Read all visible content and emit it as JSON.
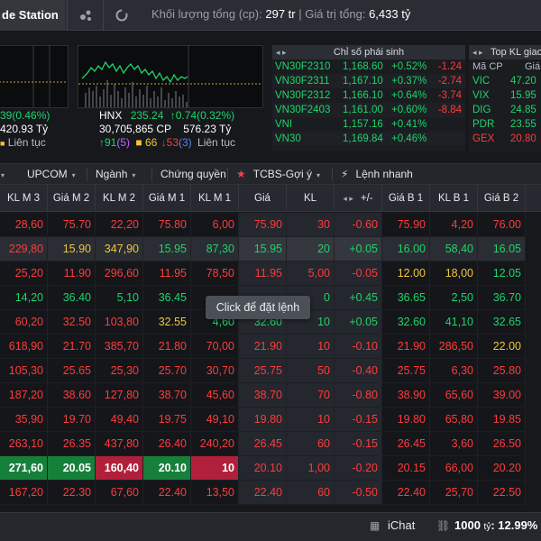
{
  "topbar": {
    "brand": "de Station",
    "volume_label": "Khối lượng tổng (cp):",
    "volume_value": "297 tr",
    "separator": "|",
    "value_label": "Giá trị tổng:",
    "value_value": "6,433 tỷ"
  },
  "index_left": {
    "change": "39(0.46%)",
    "value": "420.93 Tỷ",
    "status": "Liên tục"
  },
  "index_hnx": {
    "name": "HNX",
    "price": "235.24",
    "change": "↑0.74(0.32%)",
    "volume": "30,705,865 CP",
    "value": "576.23 Tỷ",
    "up": "↑91",
    "ceiling": "(5)",
    "ref": "■ 66",
    "down": "↓53",
    "floor": "(3)",
    "status": "Liên tục"
  },
  "derivatives": {
    "arrows": "◂ ▸",
    "title": "Chỉ số phái sinh",
    "rows": [
      {
        "code": "VN30F2310",
        "price": "1,168.60",
        "pct": "+0.52%",
        "diff": "-1.24"
      },
      {
        "code": "VN30F2311",
        "price": "1,167.10",
        "pct": "+0.37%",
        "diff": "-2.74"
      },
      {
        "code": "VN30F2312",
        "price": "1,166.10",
        "pct": "+0.64%",
        "diff": "-3.74"
      },
      {
        "code": "VN30F2403",
        "price": "1,161.00",
        "pct": "+0.60%",
        "diff": "-8.84"
      },
      {
        "code": "VNI",
        "price": "1,157.16",
        "pct": "+0.41%",
        "diff": ""
      },
      {
        "code": "VN30",
        "price": "1,169.84",
        "pct": "+0.46%",
        "diff": ""
      }
    ]
  },
  "topkl": {
    "arrows": "◂ ▸",
    "title": "Top KL giao",
    "col_code": "Mã CP",
    "col_price": "Giá",
    "rows": [
      {
        "code": "VIC",
        "price": "47.20",
        "color": "green"
      },
      {
        "code": "VIX",
        "price": "15.95",
        "color": "green"
      },
      {
        "code": "DIG",
        "price": "24.85",
        "color": "green"
      },
      {
        "code": "PDR",
        "price": "23.55",
        "color": "green"
      },
      {
        "code": "GEX",
        "price": "20.80",
        "color": "red"
      }
    ]
  },
  "tabs": [
    {
      "label": "UPCOM",
      "caret": "▾"
    },
    {
      "label": "Ngành",
      "caret": "▾"
    },
    {
      "label": "Chứng quyền",
      "caret": ""
    },
    {
      "label": "TCBS-Gợi ý",
      "caret": "▾",
      "icon": "★"
    },
    {
      "label": "Lệnh nhanh",
      "caret": "",
      "icon": "⚡"
    }
  ],
  "columns": [
    "KL M 3",
    "Giá M 2",
    "KL M 2",
    "Giá M 1",
    "KL M 1",
    "Giá",
    "KL",
    "+/-",
    "Giá B 1",
    "KL B 1",
    "Giá B 2"
  ],
  "columns_arrows": "◂ ▸",
  "rows": [
    {
      "cells": [
        "28,60",
        "75.70",
        "22,20",
        "75.80",
        "6,00",
        "75.90",
        "30",
        "-0.60",
        "75.90",
        "4,20",
        "76.00"
      ],
      "colors": [
        "r",
        "r",
        "r",
        "r",
        "r",
        "r",
        "r",
        "r",
        "r",
        "r",
        "r"
      ]
    },
    {
      "cells": [
        "229,80",
        "15.90",
        "347,90",
        "15.95",
        "87,30",
        "15.95",
        "20",
        "+0.05",
        "16.00",
        "58,40",
        "16.05"
      ],
      "colors": [
        "r",
        "y",
        "y",
        "g",
        "g",
        "g",
        "g",
        "g",
        "g",
        "g",
        "g"
      ]
    },
    {
      "cells": [
        "25,20",
        "11.90",
        "296,60",
        "11.95",
        "78,50",
        "11.95",
        "5,00",
        "-0.05",
        "12.00",
        "18,00",
        "12.05"
      ],
      "colors": [
        "r",
        "r",
        "r",
        "r",
        "r",
        "r",
        "r",
        "r",
        "y",
        "y",
        "g"
      ]
    },
    {
      "cells": [
        "14,20",
        "36.40",
        "5,10",
        "36.45",
        "",
        "",
        "0",
        "+0.45",
        "36.65",
        "2,50",
        "36.70"
      ],
      "colors": [
        "g",
        "g",
        "g",
        "g",
        "g",
        "g",
        "g",
        "g",
        "g",
        "g",
        "g"
      ]
    },
    {
      "cells": [
        "60,20",
        "32.50",
        "103,80",
        "32.55",
        "4,60",
        "32.60",
        "10",
        "+0.05",
        "32.60",
        "41,10",
        "32.65"
      ],
      "colors": [
        "r",
        "r",
        "r",
        "y",
        "g",
        "g",
        "g",
        "g",
        "g",
        "g",
        "g"
      ]
    },
    {
      "cells": [
        "618,90",
        "21.70",
        "385,70",
        "21.80",
        "70,00",
        "21.90",
        "10",
        "-0.10",
        "21.90",
        "286,50",
        "22.00"
      ],
      "colors": [
        "r",
        "r",
        "r",
        "r",
        "r",
        "r",
        "r",
        "r",
        "r",
        "r",
        "y"
      ]
    },
    {
      "cells": [
        "105,30",
        "25.65",
        "25,30",
        "25.70",
        "30,70",
        "25.75",
        "50",
        "-0.40",
        "25.75",
        "6,30",
        "25.80"
      ],
      "colors": [
        "r",
        "r",
        "r",
        "r",
        "r",
        "r",
        "r",
        "r",
        "r",
        "r",
        "r"
      ]
    },
    {
      "cells": [
        "187,20",
        "38.60",
        "127,80",
        "38.70",
        "45,60",
        "38.70",
        "70",
        "-0.80",
        "38.90",
        "65,60",
        "39.00"
      ],
      "colors": [
        "r",
        "r",
        "r",
        "r",
        "r",
        "r",
        "r",
        "r",
        "r",
        "r",
        "r"
      ]
    },
    {
      "cells": [
        "35,90",
        "19.70",
        "49,40",
        "19.75",
        "49,10",
        "19.80",
        "10",
        "-0.15",
        "19.80",
        "65,80",
        "19.85"
      ],
      "colors": [
        "r",
        "r",
        "r",
        "r",
        "r",
        "r",
        "r",
        "r",
        "r",
        "r",
        "r"
      ]
    },
    {
      "cells": [
        "263,10",
        "26.35",
        "437,80",
        "26.40",
        "240,20",
        "26.45",
        "60",
        "-0.15",
        "26.45",
        "3,60",
        "26.50"
      ],
      "colors": [
        "r",
        "r",
        "r",
        "r",
        "r",
        "r",
        "r",
        "r",
        "r",
        "r",
        "r"
      ]
    },
    {
      "cells": [
        "271,60",
        "20.05",
        "160,40",
        "20.10",
        "10",
        "20.10",
        "1,00",
        "-0.20",
        "20.15",
        "66,00",
        "20.20"
      ],
      "colors": [
        "w",
        "w",
        "w",
        "w",
        "w",
        "r",
        "r",
        "r",
        "r",
        "r",
        "r"
      ]
    },
    {
      "cells": [
        "167,20",
        "22.30",
        "67,60",
        "22.40",
        "13,50",
        "22.40",
        "60",
        "-0.50",
        "22.40",
        "25,70",
        "22.50"
      ],
      "colors": [
        "r",
        "r",
        "r",
        "r",
        "r",
        "r",
        "r",
        "r",
        "r",
        "r",
        "r"
      ]
    }
  ],
  "tooltip": "Click để đặt lệnh",
  "statusbar": {
    "chat_label": "iChat",
    "amount": "1000",
    "amount_unit": "tỷ",
    "percent": ": 12.99%"
  },
  "colors": {
    "up": "#1fd46a",
    "down": "#ff3b3b",
    "ref": "#f0c43c",
    "ceiling": "#c065ff",
    "floor": "#4f86ff"
  }
}
